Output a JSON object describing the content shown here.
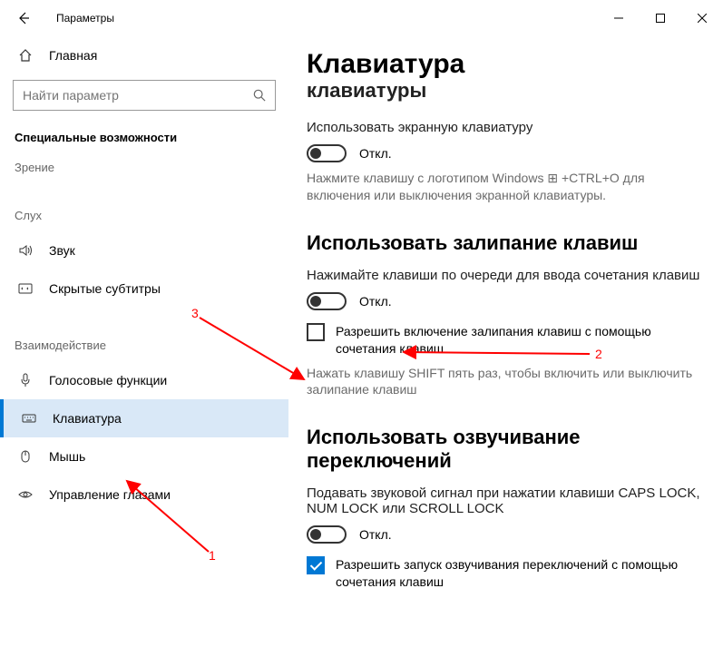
{
  "window": {
    "title": "Параметры"
  },
  "sidebar": {
    "home": "Главная",
    "search_placeholder": "Найти параметр",
    "group": "Специальные возможности",
    "cat_vision": "Зрение",
    "cat_hearing": "Слух",
    "cat_interaction": "Взаимодействие",
    "items": {
      "sound": "Звук",
      "captions": "Скрытые субтитры",
      "speech": "Голосовые функции",
      "keyboard": "Клавиатура",
      "mouse": "Мышь",
      "eye": "Управление глазами"
    }
  },
  "main": {
    "title": "Клавиатура",
    "cutoff_heading": "Использовать устройство без обычной клавиатуры",
    "osk_desc": "Использовать экранную клавиатуру",
    "off": "Откл.",
    "osk_hint_pre": "Нажмите клавишу с логотипом Windows ",
    "osk_hint_post": " +CTRL+O для включения или выключения экранной клавиатуры.",
    "sticky_h": "Использовать залипание клавиш",
    "sticky_desc": "Нажимайте клавиши по очереди для ввода сочетания клавиш",
    "sticky_chk": "Разрешить включение залипания клавиш с помощью сочетания клавиш",
    "sticky_hint": "Нажать клавишу SHIFT пять раз, чтобы включить или выключить залипание клавиш",
    "toggle_h": "Использовать озвучивание переключений",
    "toggle_desc": "Подавать звуковой сигнал при нажатии клавиши CAPS LOCK, NUM LOCK или SCROLL LOCK",
    "toggle_chk": "Разрешить запуск озвучивания переключений с помощью сочетания клавиш"
  },
  "annotations": {
    "n1": "1",
    "n2": "2",
    "n3": "3"
  }
}
